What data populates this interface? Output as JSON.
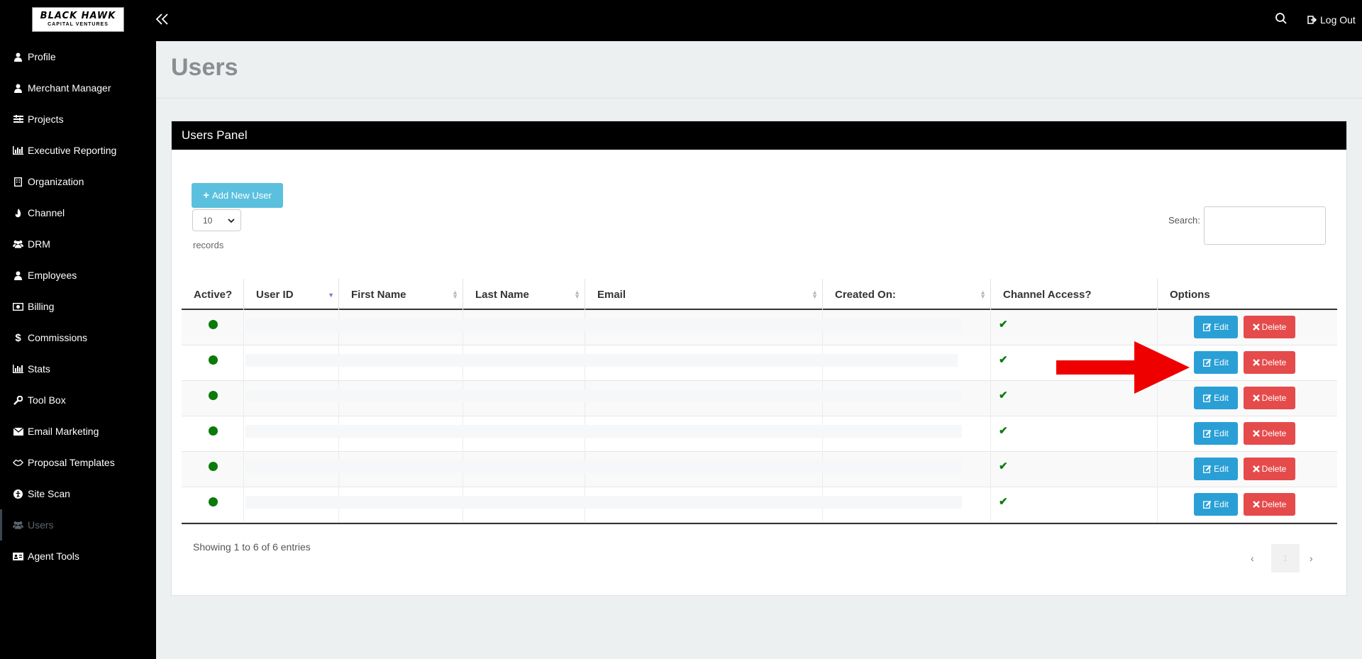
{
  "logo": {
    "main": "BLACK HAWK",
    "sub": "CAPITAL VENTURES"
  },
  "topbar": {
    "collapse": "«",
    "logout": "Log Out",
    "search_icon": "search-icon"
  },
  "sidebar": {
    "items": [
      {
        "label": "Profile",
        "icon": "user-icon"
      },
      {
        "label": "Merchant Manager",
        "icon": "user-icon"
      },
      {
        "label": "Projects",
        "icon": "sliders-icon"
      },
      {
        "label": "Executive Reporting",
        "icon": "bar-chart-icon"
      },
      {
        "label": "Organization",
        "icon": "building-icon"
      },
      {
        "label": "Channel",
        "icon": "fire-icon"
      },
      {
        "label": "DRM",
        "icon": "users-icon"
      },
      {
        "label": "Employees",
        "icon": "user-icon"
      },
      {
        "label": "Billing",
        "icon": "money-icon"
      },
      {
        "label": "Commissions",
        "icon": "dollar-icon"
      },
      {
        "label": "Stats",
        "icon": "bar-chart-icon"
      },
      {
        "label": "Tool Box",
        "icon": "wrench-icon"
      },
      {
        "label": "Email Marketing",
        "icon": "envelope-icon"
      },
      {
        "label": "Proposal Templates",
        "icon": "handshake-icon"
      },
      {
        "label": "Site Scan",
        "icon": "universal-access-icon"
      },
      {
        "label": "Users",
        "icon": "users-icon",
        "active": true
      },
      {
        "label": "Agent Tools",
        "icon": "id-card-icon"
      }
    ]
  },
  "page": {
    "title": "Users"
  },
  "panel": {
    "heading": "Users Panel",
    "add_button": "Add New User",
    "page_length": "10",
    "records_label": "records",
    "search_label": "Search:"
  },
  "table": {
    "columns": [
      "Active?",
      "User ID",
      "First Name",
      "Last Name",
      "Email",
      "Created On:",
      "Channel Access?",
      "Options"
    ],
    "row_count": 6,
    "edit_label": "Edit",
    "delete_label": "Delete",
    "info": "Showing 1 to 6 of 6 entries",
    "pagination": {
      "prev": "‹",
      "page": "1",
      "next": "›"
    }
  },
  "colors": {
    "edit": "#2a9fd6",
    "delete": "#e54b4b",
    "add": "#5bc0de",
    "active_dot": "#0a7a0a",
    "arrow": "#ee0000"
  }
}
